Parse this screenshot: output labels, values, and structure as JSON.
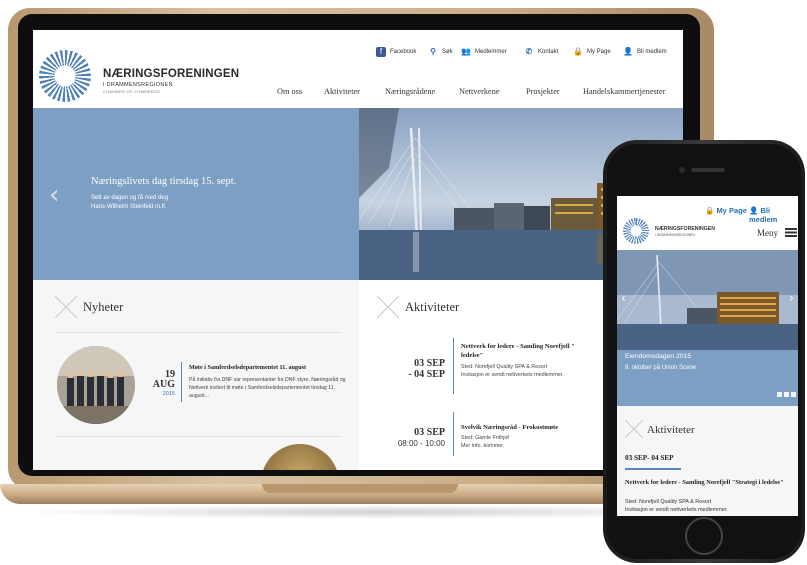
{
  "desktop": {
    "logo": {
      "name": "NÆRINGSFORENINGEN",
      "sub": "I DRAMMENSREGIONEN",
      "sub2": "CHAMBER OF COMMERCE"
    },
    "utility": [
      {
        "icon": "facebook-icon",
        "label": "Facebook"
      },
      {
        "icon": "search-icon",
        "label": "Søk"
      },
      {
        "icon": "members-icon",
        "label": "Medlemmer"
      },
      {
        "icon": "phone-icon",
        "label": "Kontakt"
      },
      {
        "icon": "lock-icon",
        "label": "My Page"
      },
      {
        "icon": "add-user-icon",
        "label": "Bli medlem"
      }
    ],
    "menu": [
      "Om oss",
      "Aktiviteter",
      "Næringsrådene",
      "Nettverkene",
      "Prosjekter",
      "Handelskammertjenester"
    ],
    "hero": {
      "title": "Næringslivets dag tirsdag 15. sept.",
      "sub_line1": "Sett av dagen og få med deg",
      "sub_line2": "Hans-Wilhelm Steinfeld m.fl."
    },
    "news": {
      "heading": "Nyheter",
      "item": {
        "day": "19",
        "month": "AUG",
        "year": "2015",
        "title": "Møte i Samferdselsdepartementet 11. august",
        "text": "På initiativ fra DNF var representanter fra DNF styre, Næringsråd og Nettverk invitert til møte i Samferdselsdepartementet tirsdag 11. august..."
      }
    },
    "activities": {
      "heading": "Aktiviteter",
      "items": [
        {
          "date1": "03 SEP",
          "date2": "- 04 SEP",
          "title": "Nettverk for ledere - Samling Norefjell \"",
          "title2": "ledelse\"",
          "place": "Sted: Norefjell Quality SPA & Resort",
          "meta": "Invitasjon er sendt nettverkets medlemmer."
        },
        {
          "date1": "03 SEP",
          "date2": "08:00 - 10:00",
          "title": "Svelvik Næringsråd - Frokostmøte",
          "title2": "",
          "place": "Sted: Gamle Frithjof",
          "meta": "Mer info. kommer."
        }
      ]
    }
  },
  "mobile": {
    "utility": {
      "mypage": "My Page",
      "join": "Bli medlem"
    },
    "logo": {
      "name": "NÆRINGSFORENINGEN",
      "sub": "I DRAMMENSREGIONEN"
    },
    "menu_label": "Meny",
    "hero": {
      "title": "Eiendomsdagen 2015",
      "sub": "8. oktober på Union Scene"
    },
    "activities": {
      "heading": "Aktiviteter",
      "date": "03 SEP- 04 SEP",
      "title": "Nettverk for ledere - Samling Norefjell \"Strategi i ledelse\"",
      "place": "Sted: Norefjell Quality SPA & Resort",
      "meta": "Invitasjon er sendt nettverkets medlemmer."
    }
  },
  "colors": {
    "accent": "#7d9fc4",
    "link": "#2b6fb2",
    "green": "#3f9b3a"
  }
}
